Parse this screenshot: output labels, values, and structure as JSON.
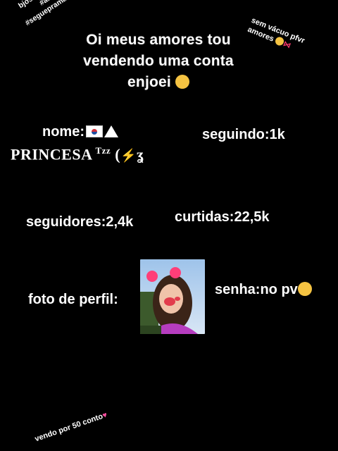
{
  "title_lines": [
    "Oi meus amores tou",
    "vendendo uma conta",
    "enjoei"
  ],
  "top_left_note": [
    "bjos da loloh",
    "#amovxs",
    "#seguepramaisvideos"
  ],
  "top_right_note": [
    "sem vácuo pfvr",
    "amores"
  ],
  "nome_label": "nome:",
  "username": "PRINCESA",
  "username_suffix": "Tzz",
  "seguindo": "seguindo:1k",
  "seguidores": "seguidores:2,4k",
  "curtidas": "curtidas:22,5k",
  "foto_label": "foto de perfil:",
  "senha": "senha:no pv",
  "bottom_note": "vendo por 50 conto",
  "colors": {
    "background": "#000000",
    "text": "#ffffff",
    "emoji_yellow": "#f5c342",
    "heart": "#ff4fa1"
  },
  "icons": [
    "unamused-face-icon",
    "korean-flag-icon",
    "triangle-icon",
    "lightning-icon",
    "shushing-face-icon",
    "heart-icon",
    "ribbon-icon",
    "cold-face-icon"
  ]
}
